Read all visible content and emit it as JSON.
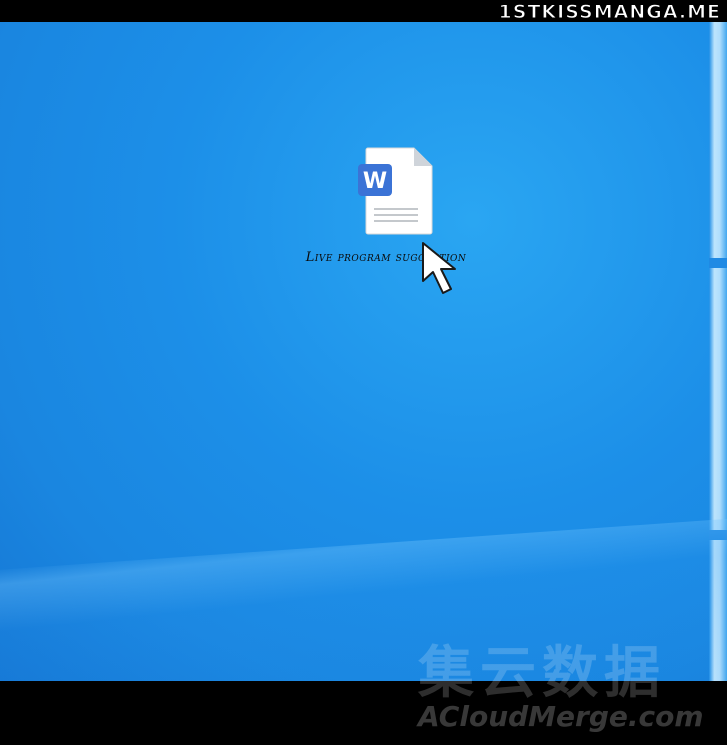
{
  "watermarks": {
    "top": "1STKISSMANGA.ME",
    "bottom_cn": "集云数据",
    "bottom_en": "ACloudMerge.com"
  },
  "desktop": {
    "background_color": "#1a86e0",
    "icons": [
      {
        "label": "Live program suggestion",
        "icon": "word-document-icon",
        "badge_letter": "W",
        "badge_color": "#3b73d6"
      }
    ]
  },
  "cursor": {
    "icon": "mouse-pointer-icon"
  }
}
